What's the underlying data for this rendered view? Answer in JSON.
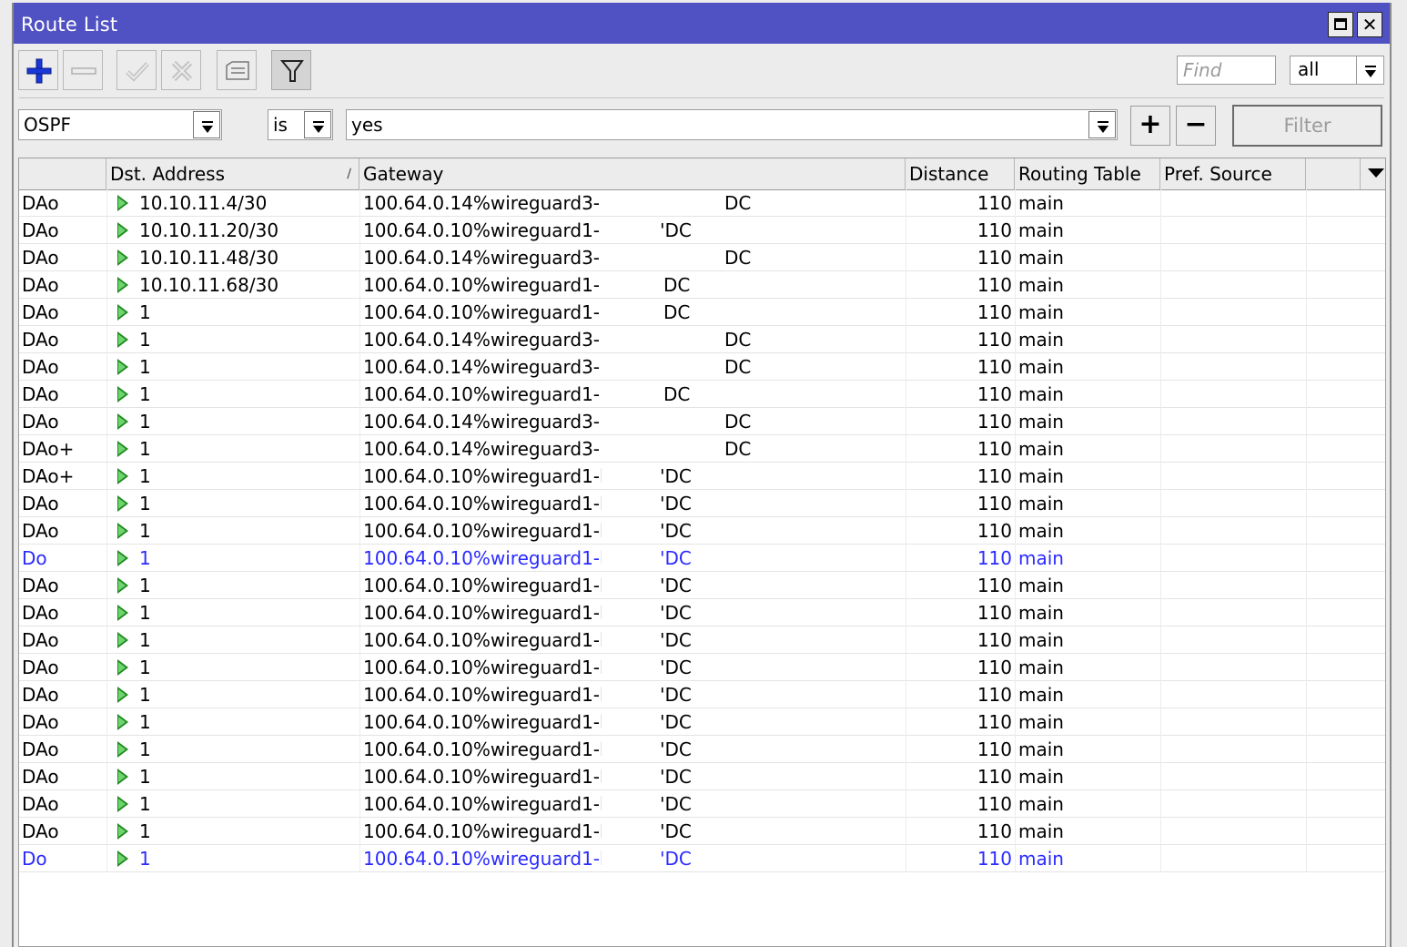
{
  "window": {
    "title": "Route List"
  },
  "toolbar": {
    "buttons": [
      {
        "name": "add",
        "icon": "plus-icon"
      },
      {
        "name": "remove",
        "icon": "minus-icon"
      },
      {
        "name": "enable",
        "icon": "check-icon"
      },
      {
        "name": "disable",
        "icon": "cross-icon"
      },
      {
        "name": "comment",
        "icon": "comment-icon"
      },
      {
        "name": "filter",
        "icon": "funnel-icon"
      }
    ],
    "find_placeholder": "Find",
    "find_scope": "all"
  },
  "filter": {
    "field": "OSPF",
    "operator": "is",
    "value": "yes",
    "add_label": "+",
    "remove_label": "−",
    "button_label": "Filter"
  },
  "table": {
    "columns": [
      "",
      "Dst. Address",
      "Gateway",
      "Distance",
      "Routing Table",
      "Pref. Source"
    ],
    "rows": [
      {
        "flags": "DAo",
        "dst": "10.10.11.4/30",
        "gateway": "100.64.0.14%wireguard3-",
        "extra": "DC",
        "distance": "110",
        "table": "main",
        "blue": false
      },
      {
        "flags": "DAo",
        "dst": "10.10.11.20/30",
        "gateway": "100.64.0.10%wireguard1-",
        "extra": "'DC",
        "distance": "110",
        "table": "main",
        "blue": false
      },
      {
        "flags": "DAo",
        "dst": "10.10.11.48/30",
        "gateway": "100.64.0.14%wireguard3-",
        "extra": "DC",
        "distance": "110",
        "table": "main",
        "blue": false
      },
      {
        "flags": "DAo",
        "dst": "10.10.11.68/30",
        "gateway": "100.64.0.10%wireguard1-",
        "extra": "DC",
        "distance": "110",
        "table": "main",
        "blue": false
      },
      {
        "flags": "DAo",
        "dst": "1",
        "gateway": "100.64.0.10%wireguard1-",
        "extra": "DC",
        "distance": "110",
        "table": "main",
        "blue": false
      },
      {
        "flags": "DAo",
        "dst": "1",
        "gateway": "100.64.0.14%wireguard3-",
        "extra": "DC",
        "distance": "110",
        "table": "main",
        "blue": false
      },
      {
        "flags": "DAo",
        "dst": "1",
        "gateway": "100.64.0.14%wireguard3-",
        "extra": "DC",
        "distance": "110",
        "table": "main",
        "blue": false
      },
      {
        "flags": "DAo",
        "dst": "1",
        "gateway": "100.64.0.10%wireguard1-",
        "extra": "DC",
        "distance": "110",
        "table": "main",
        "blue": false
      },
      {
        "flags": "DAo",
        "dst": "1",
        "gateway": "100.64.0.14%wireguard3-!",
        "extra": "DC",
        "distance": "110",
        "table": "main",
        "blue": false
      },
      {
        "flags": "DAo+",
        "dst": "1",
        "gateway": "100.64.0.14%wireguard3-!",
        "extra": "DC",
        "distance": "110",
        "table": "main",
        "blue": false
      },
      {
        "flags": "DAo+",
        "dst": "1",
        "gateway": "100.64.0.10%wireguard1-l",
        "extra": "'DC",
        "distance": "110",
        "table": "main",
        "blue": false
      },
      {
        "flags": "DAo",
        "dst": "1",
        "gateway": "100.64.0.10%wireguard1-l",
        "extra": "'DC",
        "distance": "110",
        "table": "main",
        "blue": false
      },
      {
        "flags": "DAo",
        "dst": "1",
        "gateway": "100.64.0.10%wireguard1-l",
        "extra": "'DC",
        "distance": "110",
        "table": "main",
        "blue": false
      },
      {
        "flags": "Do",
        "dst": "1",
        "gateway": "100.64.0.10%wireguard1-l",
        "extra": "'DC",
        "distance": "110",
        "table": "main",
        "blue": true
      },
      {
        "flags": "DAo",
        "dst": "1",
        "gateway": "100.64.0.10%wireguard1-l",
        "extra": "'DC",
        "distance": "110",
        "table": "main",
        "blue": false
      },
      {
        "flags": "DAo",
        "dst": "1",
        "gateway": "100.64.0.10%wireguard1-l",
        "extra": "'DC",
        "distance": "110",
        "table": "main",
        "blue": false
      },
      {
        "flags": "DAo",
        "dst": "1",
        "gateway": "100.64.0.10%wireguard1-l",
        "extra": "'DC",
        "distance": "110",
        "table": "main",
        "blue": false
      },
      {
        "flags": "DAo",
        "dst": "1",
        "gateway": "100.64.0.10%wireguard1-l",
        "extra": "'DC",
        "distance": "110",
        "table": "main",
        "blue": false
      },
      {
        "flags": "DAo",
        "dst": "1",
        "gateway": "100.64.0.10%wireguard1-l",
        "extra": "'DC",
        "distance": "110",
        "table": "main",
        "blue": false
      },
      {
        "flags": "DAo",
        "dst": "1",
        "gateway": "100.64.0.10%wireguard1-l",
        "extra": "'DC",
        "distance": "110",
        "table": "main",
        "blue": false
      },
      {
        "flags": "DAo",
        "dst": "1",
        "gateway": "100.64.0.10%wireguard1-l",
        "extra": "'DC",
        "distance": "110",
        "table": "main",
        "blue": false
      },
      {
        "flags": "DAo",
        "dst": "1",
        "gateway": "100.64.0.10%wireguard1-l",
        "extra": "'DC",
        "distance": "110",
        "table": "main",
        "blue": false
      },
      {
        "flags": "DAo",
        "dst": "1",
        "gateway": "100.64.0.10%wireguard1-l",
        "extra": "'DC",
        "distance": "110",
        "table": "main",
        "blue": false
      },
      {
        "flags": "DAo",
        "dst": "1",
        "gateway": "100.64.0.10%wireguard1-l",
        "extra": "'DC",
        "distance": "110",
        "table": "main",
        "blue": false
      },
      {
        "flags": "Do",
        "dst": "1",
        "gateway": "100.64.0.10%wireguard1-l",
        "extra": "'DC",
        "distance": "110",
        "table": "main",
        "blue": true
      }
    ]
  },
  "colors": {
    "titlebar": "#5052c4",
    "inactive_row_text": "#2a2aff",
    "route_arrow": "#1e8a1e"
  }
}
